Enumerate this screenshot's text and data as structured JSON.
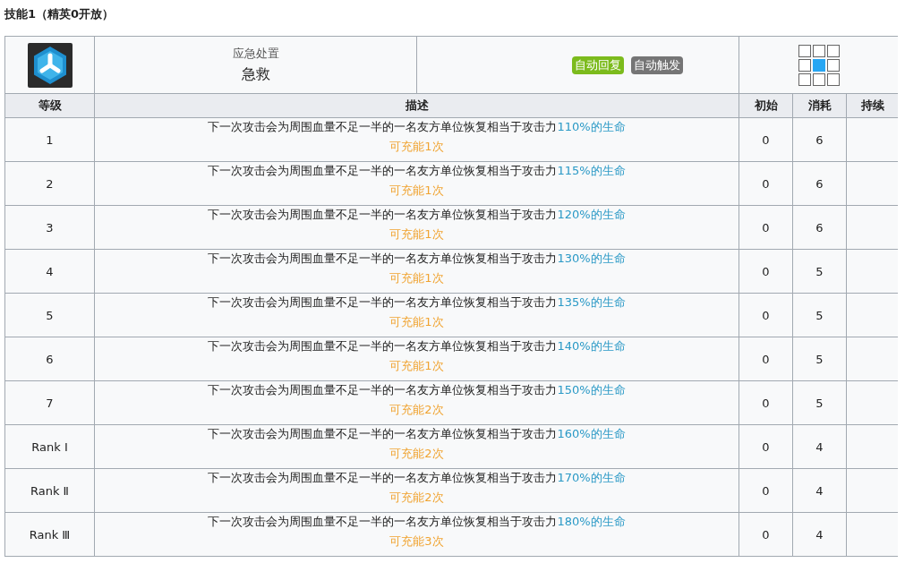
{
  "title": "技能1（精英0开放）",
  "skill": {
    "category": "应急处置",
    "name": "急救",
    "tags": [
      {
        "label": "自动回复",
        "color": "#7cbb1c"
      },
      {
        "label": "自动触发",
        "color": "#757575"
      }
    ],
    "range": [
      [
        {
          "selected": false
        },
        {
          "selected": false
        },
        {
          "selected": false
        }
      ],
      [
        {
          "selected": false
        },
        {
          "selected": true
        },
        {
          "selected": false
        }
      ],
      [
        {
          "selected": false
        },
        {
          "selected": false
        },
        {
          "selected": false
        }
      ]
    ]
  },
  "columns": [
    "等级",
    "描述",
    "初始",
    "消耗",
    "持续"
  ],
  "rows": [
    {
      "level": "1",
      "text": "下一次攻击会为周围血量不足一半的一名友方单位恢复相当于攻击力",
      "highlight": "110%的生命",
      "charges": "可充能1次",
      "initial": "0",
      "cost": "6"
    },
    {
      "level": "2",
      "text": "下一次攻击会为周围血量不足一半的一名友方单位恢复相当于攻击力",
      "highlight": "115%的生命",
      "charges": "可充能1次",
      "initial": "0",
      "cost": "6"
    },
    {
      "level": "3",
      "text": "下一次攻击会为周围血量不足一半的一名友方单位恢复相当于攻击力",
      "highlight": "120%的生命",
      "charges": "可充能1次",
      "initial": "0",
      "cost": "6"
    },
    {
      "level": "4",
      "text": "下一次攻击会为周围血量不足一半的一名友方单位恢复相当于攻击力",
      "highlight": "130%的生命",
      "charges": "可充能1次",
      "initial": "0",
      "cost": "5"
    },
    {
      "level": "5",
      "text": "下一次攻击会为周围血量不足一半的一名友方单位恢复相当于攻击力",
      "highlight": "135%的生命",
      "charges": "可充能1次",
      "initial": "0",
      "cost": "5"
    },
    {
      "level": "6",
      "text": "下一次攻击会为周围血量不足一半的一名友方单位恢复相当于攻击力",
      "highlight": "140%的生命",
      "charges": "可充能1次",
      "initial": "0",
      "cost": "5"
    },
    {
      "level": "7",
      "text": "下一次攻击会为周围血量不足一半的一名友方单位恢复相当于攻击力",
      "highlight": "150%的生命",
      "charges": "可充能2次",
      "initial": "0",
      "cost": "5"
    },
    {
      "level": "Rank Ⅰ",
      "text": "下一次攻击会为周围血量不足一半的一名友方单位恢复相当于攻击力",
      "highlight": "160%的生命",
      "charges": "可充能2次",
      "initial": "0",
      "cost": "4"
    },
    {
      "level": "Rank Ⅱ",
      "text": "下一次攻击会为周围血量不足一半的一名友方单位恢复相当于攻击力",
      "highlight": "170%的生命",
      "charges": "可充能2次",
      "initial": "0",
      "cost": "4"
    },
    {
      "level": "Rank Ⅲ",
      "text": "下一次攻击会为周围血量不足一半的一名友方单位恢复相当于攻击力",
      "highlight": "180%的生命",
      "charges": "可充能3次",
      "initial": "0",
      "cost": "4"
    }
  ]
}
